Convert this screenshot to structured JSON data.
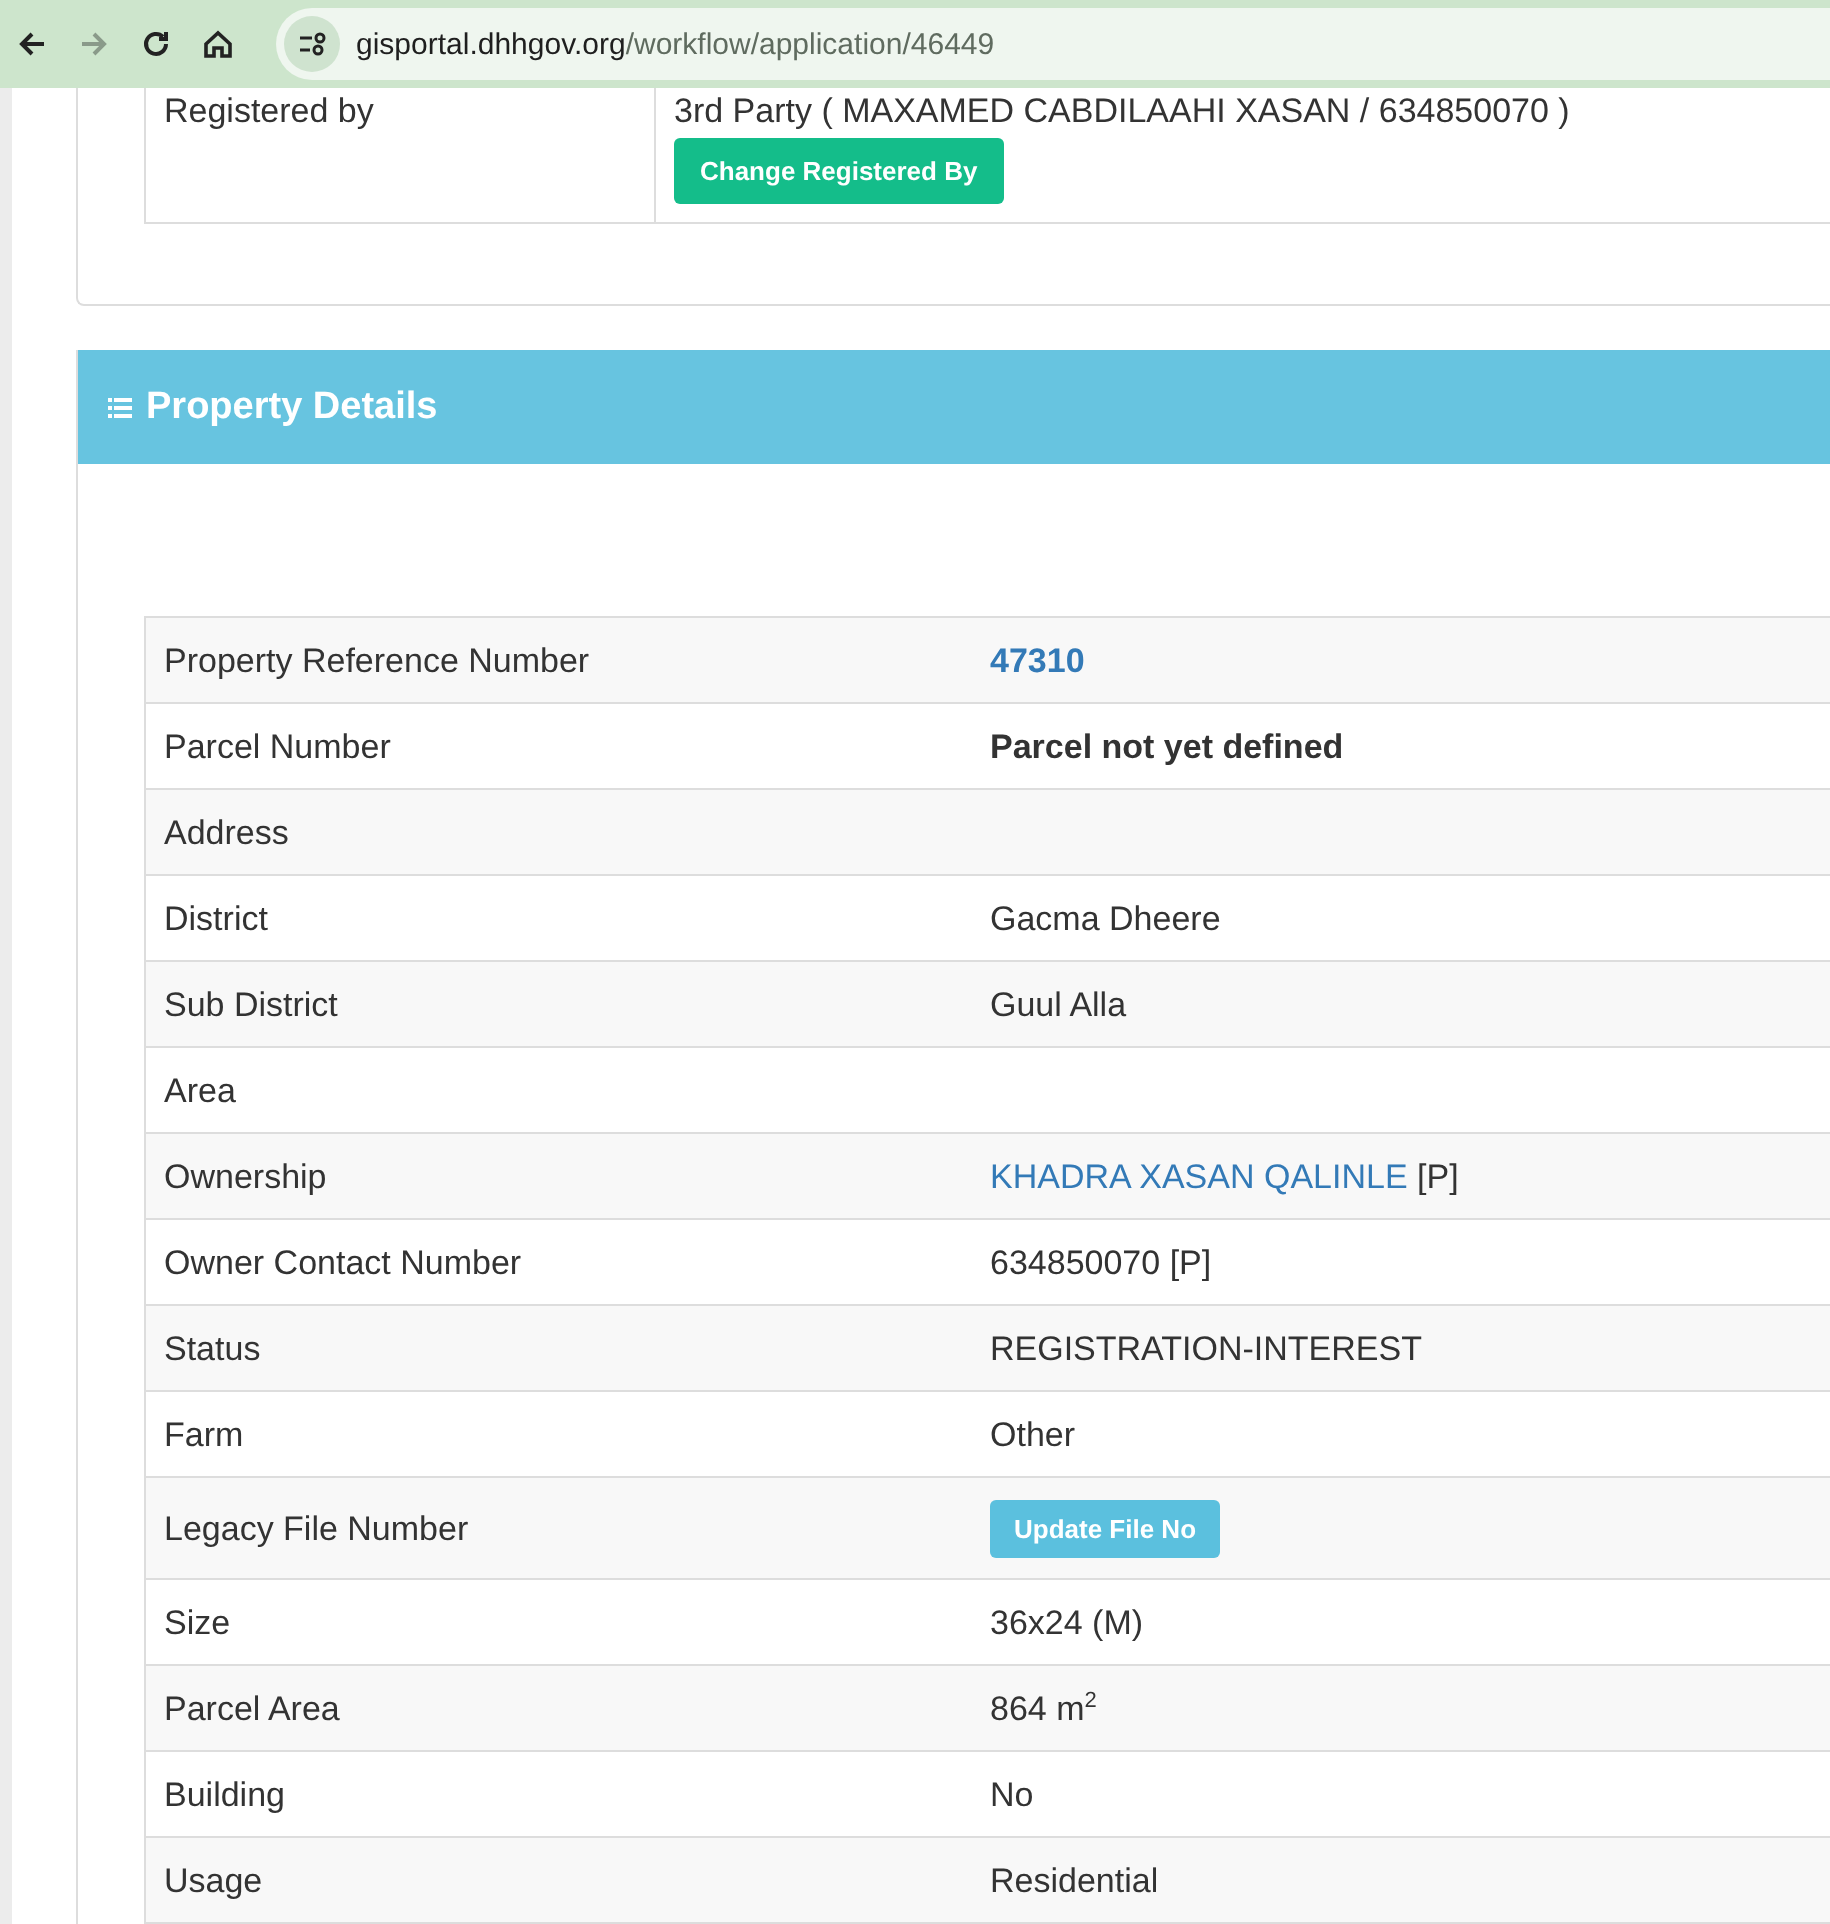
{
  "browser": {
    "url_host": "gisportal.dhhgov.org",
    "url_path": "/workflow/application/46449"
  },
  "registration": {
    "label": "Registered by",
    "value": "3rd Party ( MAXAMED CABDILAAHI XASAN / 634850070 )",
    "button": "Change Registered By"
  },
  "panel": {
    "title": "Property Details"
  },
  "rows": [
    {
      "label": "Property Reference Number",
      "kind": "link",
      "value": "47310"
    },
    {
      "label": "Parcel Number",
      "kind": "bold",
      "value": "Parcel not yet defined"
    },
    {
      "label": "Address",
      "kind": "empty"
    },
    {
      "label": "District",
      "kind": "text",
      "value": "Gacma Dheere"
    },
    {
      "label": "Sub District",
      "kind": "text",
      "value": "Guul Alla"
    },
    {
      "label": "Area",
      "kind": "empty"
    },
    {
      "label": "Ownership",
      "kind": "owner",
      "value": "KHADRA XASAN QALINLE",
      "suffix": "[P]"
    },
    {
      "label": "Owner Contact Number",
      "kind": "text",
      "value": "634850070 [P]"
    },
    {
      "label": "Status",
      "kind": "text",
      "value": "REGISTRATION-INTEREST"
    },
    {
      "label": "Farm",
      "kind": "text",
      "value": "Other"
    },
    {
      "label": "Legacy File Number",
      "kind": "button",
      "value": "Update File No"
    },
    {
      "label": "Size",
      "kind": "text",
      "value": "36x24 (M)"
    },
    {
      "label": "Parcel Area",
      "kind": "rich",
      "value": "864 m$^{2}$"
    },
    {
      "label": "Building",
      "kind": "text",
      "value": "No"
    },
    {
      "label": "Usage",
      "kind": "text",
      "value": "Residential"
    }
  ]
}
